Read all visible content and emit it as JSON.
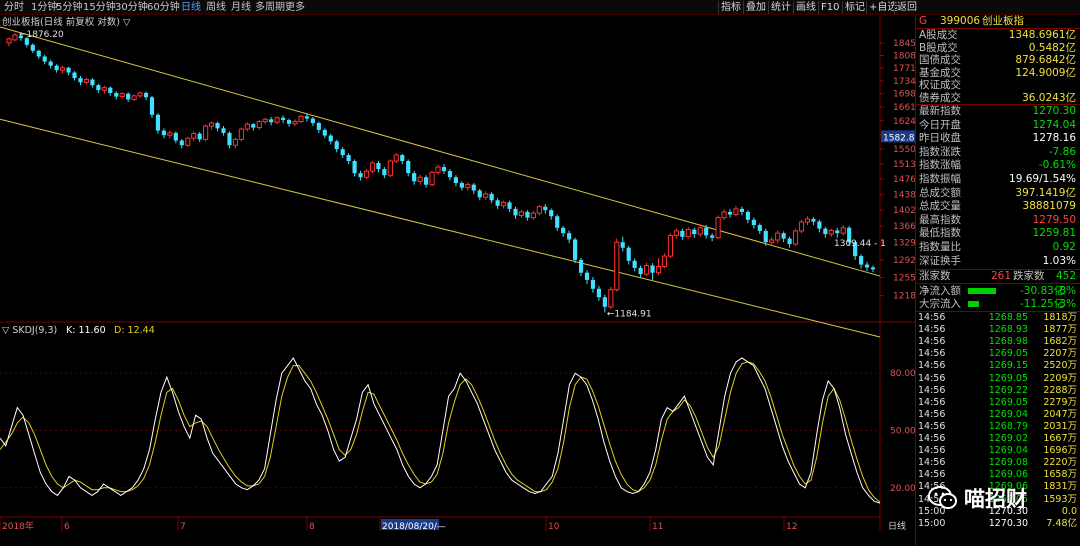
{
  "toolbar": {
    "periods": [
      "分时",
      "1分钟",
      "5分钟",
      "15分钟",
      "30分钟",
      "60分钟",
      "日线",
      "周线",
      "月线",
      "多周期",
      "更多"
    ],
    "active_period": "日线",
    "tools": [
      "指标",
      "叠加",
      "统计",
      "画线",
      "F10",
      "标记",
      "+自选",
      "返回"
    ]
  },
  "chart": {
    "title": "创业板指(日线 前复权 对数) ▽",
    "high_marker": "1876.20",
    "low_marker": "1184.91",
    "right_marker": "1309.44 - 1",
    "current_price_tag": "1582.8",
    "price_axis": [
      "1845",
      "1808",
      "1771",
      "1734",
      "1698",
      "1661",
      "1624",
      "1587",
      "1550",
      "1513",
      "1476",
      "1438",
      "1402",
      "1366",
      "1329",
      "1292",
      "1255",
      "1218"
    ],
    "indicator_title": "▽ SKDJ(9,3)",
    "indicator_k": "K: 11.60",
    "indicator_d": "D: 12.44",
    "indicator_axis": [
      "80.00",
      "50.00",
      "20.00"
    ],
    "date_axis": [
      "2018年",
      "6",
      "7",
      "8",
      "2018/08/20/—",
      "10",
      "11",
      "12"
    ],
    "bottom_right_label": "日线"
  },
  "chart_data": {
    "type": "candlestick",
    "colors": {
      "up": "#ff3030",
      "down": "#40e0ff",
      "k_line": "#ffffff",
      "d_line": "#e0d020",
      "channel": "#d8c840"
    },
    "y_range": [
      1180,
      1870
    ],
    "candles": [
      [
        1846,
        1858,
        1835,
        1862
      ],
      [
        1855,
        1870,
        1850,
        1876.2
      ],
      [
        1868,
        1860,
        1852,
        1872
      ],
      [
        1860,
        1840,
        1832,
        1864
      ],
      [
        1840,
        1822,
        1815,
        1845
      ],
      [
        1822,
        1805,
        1798,
        1826
      ],
      [
        1805,
        1790,
        1782,
        1810
      ],
      [
        1790,
        1778,
        1770,
        1795
      ],
      [
        1778,
        1765,
        1758,
        1782
      ],
      [
        1765,
        1772,
        1755,
        1778
      ],
      [
        1772,
        1758,
        1750,
        1775
      ],
      [
        1758,
        1742,
        1735,
        1762
      ],
      [
        1742,
        1730,
        1722,
        1748
      ],
      [
        1730,
        1738,
        1724,
        1742
      ],
      [
        1738,
        1722,
        1715,
        1742
      ],
      [
        1722,
        1708,
        1700,
        1726
      ],
      [
        1708,
        1715,
        1698,
        1720
      ],
      [
        1715,
        1700,
        1692,
        1718
      ],
      [
        1700,
        1690,
        1682,
        1705
      ],
      [
        1690,
        1698,
        1684,
        1702
      ],
      [
        1698,
        1682,
        1675,
        1702
      ],
      [
        1682,
        1692,
        1678,
        1696
      ],
      [
        1692,
        1700,
        1686,
        1704
      ],
      [
        1700,
        1688,
        1680,
        1704
      ],
      [
        1688,
        1640,
        1632,
        1692
      ],
      [
        1640,
        1598,
        1590,
        1644
      ],
      [
        1598,
        1586,
        1578,
        1604
      ],
      [
        1586,
        1592,
        1578,
        1598
      ],
      [
        1592,
        1572,
        1565,
        1596
      ],
      [
        1572,
        1560,
        1552,
        1576
      ],
      [
        1560,
        1578,
        1555,
        1582
      ],
      [
        1578,
        1590,
        1570,
        1596
      ],
      [
        1590,
        1575,
        1568,
        1594
      ],
      [
        1575,
        1610,
        1570,
        1614
      ],
      [
        1610,
        1618,
        1600,
        1622
      ],
      [
        1618,
        1604,
        1596,
        1622
      ],
      [
        1604,
        1592,
        1585,
        1610
      ],
      [
        1592,
        1560,
        1552,
        1596
      ],
      [
        1560,
        1575,
        1552,
        1580
      ],
      [
        1575,
        1602,
        1570,
        1606
      ],
      [
        1602,
        1615,
        1596,
        1620
      ],
      [
        1615,
        1606,
        1598,
        1618
      ],
      [
        1606,
        1622,
        1600,
        1626
      ],
      [
        1622,
        1628,
        1615,
        1632
      ],
      [
        1628,
        1620,
        1612,
        1634
      ],
      [
        1620,
        1632,
        1615,
        1636
      ],
      [
        1632,
        1626,
        1618,
        1638
      ],
      [
        1626,
        1616,
        1608,
        1630
      ],
      [
        1616,
        1622,
        1610,
        1628
      ],
      [
        1622,
        1636,
        1618,
        1640
      ],
      [
        1636,
        1630,
        1622,
        1642
      ],
      [
        1630,
        1618,
        1610,
        1634
      ],
      [
        1618,
        1600,
        1592,
        1622
      ],
      [
        1600,
        1585,
        1578,
        1604
      ],
      [
        1585,
        1570,
        1562,
        1590
      ],
      [
        1570,
        1550,
        1542,
        1574
      ],
      [
        1550,
        1535,
        1528,
        1555
      ],
      [
        1535,
        1520,
        1512,
        1540
      ],
      [
        1520,
        1490,
        1482,
        1524
      ],
      [
        1490,
        1480,
        1472,
        1496
      ],
      [
        1480,
        1495,
        1476,
        1500
      ],
      [
        1495,
        1515,
        1490,
        1520
      ],
      [
        1515,
        1500,
        1492,
        1520
      ],
      [
        1500,
        1485,
        1478,
        1505
      ],
      [
        1485,
        1520,
        1480,
        1524
      ],
      [
        1520,
        1535,
        1515,
        1540
      ],
      [
        1535,
        1520,
        1512,
        1538
      ],
      [
        1520,
        1490,
        1482,
        1524
      ],
      [
        1490,
        1470,
        1462,
        1495
      ],
      [
        1470,
        1480,
        1462,
        1486
      ],
      [
        1480,
        1462,
        1455,
        1485
      ],
      [
        1462,
        1492,
        1458,
        1496
      ],
      [
        1492,
        1505,
        1486,
        1510
      ],
      [
        1505,
        1495,
        1488,
        1512
      ],
      [
        1495,
        1480,
        1472,
        1500
      ],
      [
        1480,
        1466,
        1458,
        1485
      ],
      [
        1466,
        1455,
        1448,
        1470
      ],
      [
        1455,
        1462,
        1448,
        1468
      ],
      [
        1462,
        1448,
        1440,
        1466
      ],
      [
        1448,
        1432,
        1425,
        1452
      ],
      [
        1432,
        1440,
        1426,
        1446
      ],
      [
        1440,
        1425,
        1418,
        1444
      ],
      [
        1425,
        1412,
        1405,
        1430
      ],
      [
        1412,
        1420,
        1406,
        1424
      ],
      [
        1420,
        1405,
        1398,
        1424
      ],
      [
        1405,
        1390,
        1382,
        1410
      ],
      [
        1390,
        1398,
        1384,
        1402
      ],
      [
        1398,
        1385,
        1378,
        1402
      ],
      [
        1385,
        1395,
        1380,
        1400
      ],
      [
        1395,
        1410,
        1390,
        1414
      ],
      [
        1410,
        1402,
        1394,
        1416
      ],
      [
        1402,
        1388,
        1380,
        1406
      ],
      [
        1388,
        1362,
        1355,
        1392
      ],
      [
        1362,
        1350,
        1342,
        1366
      ],
      [
        1350,
        1336,
        1328,
        1356
      ],
      [
        1336,
        1292,
        1285,
        1340
      ],
      [
        1292,
        1265,
        1258,
        1296
      ],
      [
        1265,
        1250,
        1242,
        1270
      ],
      [
        1250,
        1232,
        1224,
        1256
      ],
      [
        1232,
        1215,
        1208,
        1238
      ],
      [
        1215,
        1196,
        1184.91,
        1220
      ],
      [
        1196,
        1230,
        1192,
        1236
      ],
      [
        1230,
        1330,
        1226,
        1338
      ],
      [
        1330,
        1318,
        1310,
        1342
      ],
      [
        1318,
        1290,
        1282,
        1322
      ],
      [
        1290,
        1275,
        1268,
        1295
      ],
      [
        1275,
        1262,
        1255,
        1280
      ],
      [
        1262,
        1280,
        1258,
        1286
      ],
      [
        1280,
        1265,
        1250,
        1285
      ],
      [
        1265,
        1278,
        1260,
        1296
      ],
      [
        1278,
        1300,
        1274,
        1306
      ],
      [
        1300,
        1345,
        1296,
        1350
      ],
      [
        1345,
        1355,
        1338,
        1360
      ],
      [
        1355,
        1342,
        1335,
        1360
      ],
      [
        1342,
        1358,
        1338,
        1364
      ],
      [
        1358,
        1348,
        1340,
        1362
      ],
      [
        1348,
        1362,
        1342,
        1370
      ],
      [
        1362,
        1345,
        1338,
        1368
      ],
      [
        1345,
        1340,
        1332,
        1350
      ],
      [
        1340,
        1385,
        1336,
        1390
      ],
      [
        1385,
        1398,
        1380,
        1404
      ],
      [
        1398,
        1392,
        1385,
        1405
      ],
      [
        1392,
        1405,
        1388,
        1412
      ],
      [
        1405,
        1398,
        1390,
        1410
      ],
      [
        1398,
        1380,
        1372,
        1402
      ],
      [
        1380,
        1368,
        1360,
        1385
      ],
      [
        1368,
        1355,
        1348,
        1372
      ],
      [
        1355,
        1330,
        1322,
        1360
      ],
      [
        1330,
        1335,
        1322,
        1342
      ],
      [
        1335,
        1350,
        1328,
        1356
      ],
      [
        1350,
        1338,
        1330,
        1354
      ],
      [
        1338,
        1326,
        1318,
        1342
      ],
      [
        1326,
        1355,
        1322,
        1360
      ],
      [
        1355,
        1375,
        1350,
        1380
      ],
      [
        1375,
        1382,
        1368,
        1388
      ],
      [
        1382,
        1376,
        1368,
        1386
      ],
      [
        1376,
        1360,
        1352,
        1380
      ],
      [
        1360,
        1348,
        1340,
        1364
      ],
      [
        1348,
        1356,
        1342,
        1360
      ],
      [
        1356,
        1350,
        1340,
        1362
      ],
      [
        1350,
        1362,
        1345,
        1368
      ],
      [
        1362,
        1330,
        1322,
        1366
      ],
      [
        1330,
        1300,
        1292,
        1334
      ],
      [
        1300,
        1282,
        1274,
        1304
      ],
      [
        1282,
        1276,
        1268,
        1288
      ],
      [
        1276,
        1272,
        1266,
        1280
      ]
    ],
    "k": [
      46,
      42,
      52,
      62,
      58,
      48,
      38,
      28,
      22,
      18,
      16,
      20,
      26,
      24,
      20,
      18,
      16,
      18,
      22,
      20,
      18,
      16,
      18,
      20,
      24,
      30,
      40,
      56,
      70,
      78,
      70,
      60,
      52,
      46,
      58,
      56,
      46,
      38,
      34,
      30,
      26,
      22,
      20,
      19,
      21,
      24,
      30,
      48,
      66,
      80,
      84,
      88,
      82,
      76,
      72,
      64,
      58,
      50,
      40,
      34,
      36,
      46,
      56,
      70,
      74,
      64,
      58,
      52,
      46,
      40,
      32,
      26,
      22,
      20,
      22,
      26,
      32,
      50,
      68,
      72,
      80,
      76,
      70,
      64,
      56,
      48,
      40,
      34,
      28,
      24,
      22,
      20,
      18,
      17,
      18,
      22,
      26,
      38,
      56,
      74,
      80,
      78,
      74,
      66,
      56,
      44,
      34,
      26,
      20,
      18,
      17,
      18,
      22,
      28,
      40,
      56,
      62,
      60,
      64,
      68,
      60,
      52,
      44,
      36,
      32,
      50,
      68,
      80,
      86,
      88,
      86,
      84,
      78,
      72,
      62,
      52,
      42,
      34,
      28,
      22,
      20,
      28,
      48,
      66,
      76,
      72,
      62,
      48,
      38,
      28,
      20,
      16,
      13,
      12
    ],
    "d": [
      40,
      44,
      48,
      54,
      57,
      54,
      48,
      40,
      32,
      26,
      22,
      20,
      22,
      24,
      23,
      21,
      19,
      19,
      20,
      20,
      19,
      18,
      18,
      19,
      21,
      25,
      32,
      44,
      58,
      70,
      72,
      66,
      58,
      52,
      54,
      55,
      52,
      46,
      40,
      35,
      30,
      26,
      23,
      21,
      21,
      22,
      26,
      36,
      52,
      68,
      78,
      84,
      84,
      80,
      76,
      70,
      63,
      56,
      48,
      40,
      37,
      40,
      48,
      60,
      70,
      69,
      63,
      57,
      51,
      45,
      38,
      32,
      27,
      23,
      22,
      23,
      27,
      38,
      54,
      65,
      74,
      77,
      74,
      68,
      61,
      53,
      45,
      38,
      32,
      27,
      24,
      22,
      20,
      18,
      18,
      19,
      23,
      30,
      44,
      62,
      74,
      78,
      77,
      71,
      63,
      53,
      43,
      34,
      27,
      22,
      19,
      18,
      20,
      24,
      32,
      45,
      56,
      60,
      62,
      66,
      63,
      57,
      49,
      41,
      36,
      42,
      56,
      70,
      80,
      85,
      86,
      85,
      81,
      76,
      68,
      58,
      48,
      40,
      32,
      26,
      22,
      24,
      36,
      54,
      68,
      72,
      66,
      56,
      45,
      35,
      26,
      19,
      15,
      12.4
    ]
  },
  "right_panel": {
    "header_code": "399006",
    "header_name": "创业板指",
    "header_tag": "G",
    "stats": [
      {
        "label": "A股成交",
        "value": "1348.6961亿",
        "color": "yellow"
      },
      {
        "label": "B股成交",
        "value": "0.5482亿",
        "color": "yellow"
      },
      {
        "label": "国债成交",
        "value": "879.6842亿",
        "color": "yellow"
      },
      {
        "label": "基金成交",
        "value": "124.9009亿",
        "color": "yellow"
      },
      {
        "label": "权证成交",
        "value": "",
        "color": "yellow"
      },
      {
        "label": "债券成交",
        "value": "36.0243亿",
        "color": "yellow"
      }
    ],
    "quotes": [
      {
        "label": "最新指数",
        "value": "1270.30",
        "color": "green"
      },
      {
        "label": "今日开盘",
        "value": "1274.04",
        "color": "green"
      },
      {
        "label": "昨日收盘",
        "value": "1278.16",
        "color": "white"
      },
      {
        "label": "指数涨跌",
        "value": "-7.86",
        "color": "green"
      },
      {
        "label": "指数涨幅",
        "value": "-0.61%",
        "color": "green"
      },
      {
        "label": "指数振幅",
        "value": "19.69/1.54%",
        "color": "white"
      },
      {
        "label": "总成交额",
        "value": "397.1419亿",
        "color": "yellow"
      },
      {
        "label": "总成交量",
        "value": "38881079",
        "color": "yellow"
      },
      {
        "label": "最高指数",
        "value": "1279.50",
        "color": "red"
      },
      {
        "label": "最低指数",
        "value": "1259.81",
        "color": "green"
      },
      {
        "label": "指数量比",
        "value": "0.92",
        "color": "green"
      },
      {
        "label": "深证换手",
        "value": "1.03%",
        "color": "white"
      }
    ],
    "breadth": {
      "up_label": "涨家数",
      "up_value": "261",
      "down_label": "跌家数",
      "down_value": "452"
    },
    "flows": [
      {
        "label": "净流入额",
        "value": "-30.83亿",
        "pct": "-8%",
        "bar": 0.55
      },
      {
        "label": "大宗流入",
        "value": "-11.25亿",
        "pct": "-3%",
        "bar": 0.22
      }
    ],
    "ticks": [
      {
        "time": "14:56",
        "price": "1268.85",
        "vol": "1818万"
      },
      {
        "time": "14:56",
        "price": "1268.93",
        "vol": "1877万"
      },
      {
        "time": "14:56",
        "price": "1268.98",
        "vol": "1682万"
      },
      {
        "time": "14:56",
        "price": "1269.05",
        "vol": "2207万"
      },
      {
        "time": "14:56",
        "price": "1269.15",
        "vol": "2520万"
      },
      {
        "time": "14:56",
        "price": "1269.05",
        "vol": "2209万"
      },
      {
        "time": "14:56",
        "price": "1269.22",
        "vol": "2288万"
      },
      {
        "time": "14:56",
        "price": "1269.05",
        "vol": "2279万"
      },
      {
        "time": "14:56",
        "price": "1269.04",
        "vol": "2047万"
      },
      {
        "time": "14:56",
        "price": "1268.79",
        "vol": "2031万"
      },
      {
        "time": "14:56",
        "price": "1269.02",
        "vol": "1667万"
      },
      {
        "time": "14:56",
        "price": "1269.04",
        "vol": "1696万"
      },
      {
        "time": "14:56",
        "price": "1269.08",
        "vol": "2220万"
      },
      {
        "time": "14:56",
        "price": "1269.06",
        "vol": "1658万"
      },
      {
        "time": "14:56",
        "price": "1269.06",
        "vol": "1831万"
      },
      {
        "time": "14:56",
        "price": "1269.05",
        "vol": "1593万"
      },
      {
        "time": "15:00",
        "price": "1270.30",
        "vol": "0.0"
      },
      {
        "time": "15:00",
        "price": "1270.30",
        "vol": "7.48亿"
      }
    ]
  },
  "watermark": {
    "text": "喵招财"
  }
}
